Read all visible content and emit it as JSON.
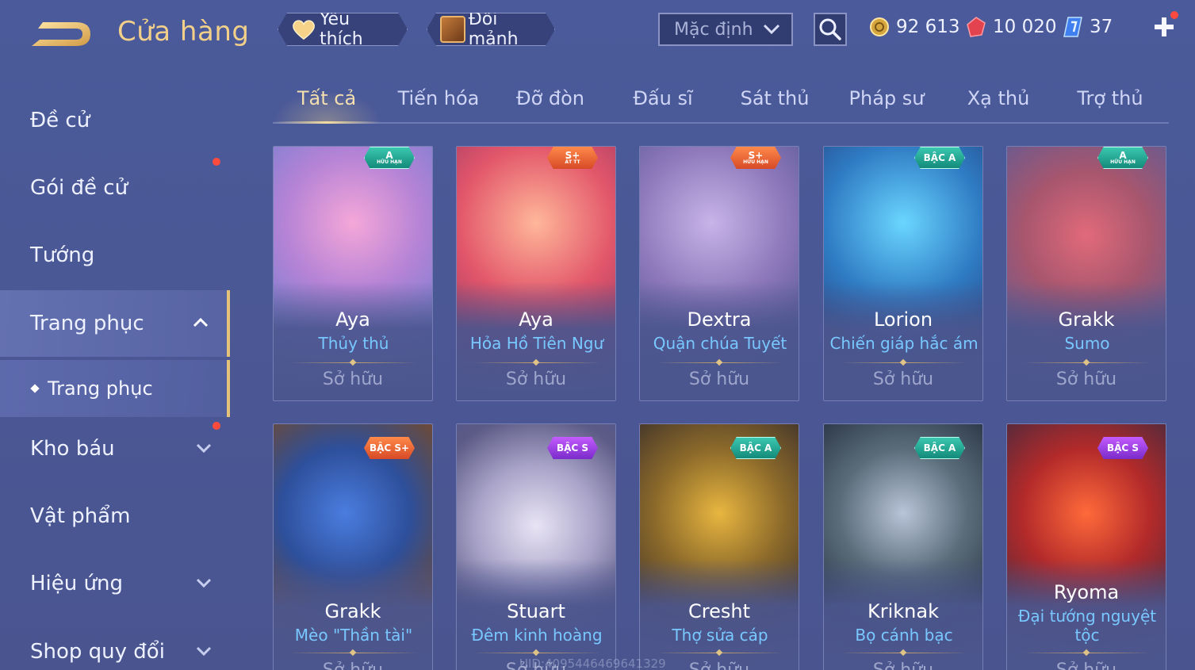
{
  "header": {
    "title": "Cửa hàng",
    "favorites_label": "Yêu thích",
    "shard_exchange_label": "Đổi mảnh",
    "sort_value": "Mặc định",
    "currencies": {
      "gold": "92 613",
      "ruby": "10 020",
      "voucher": "37"
    }
  },
  "sidebar": {
    "items": [
      {
        "label": "Đề cử"
      },
      {
        "label": "Gói đề cử"
      },
      {
        "label": "Tướng"
      },
      {
        "label": "Trang phục"
      },
      {
        "label": "Kho báu"
      },
      {
        "label": "Vật phẩm"
      },
      {
        "label": "Hiệu ứng"
      },
      {
        "label": "Shop quy đổi"
      }
    ],
    "sub_item": "Trang phục"
  },
  "tabs": [
    "Tất cả",
    "Tiến hóa",
    "Đỡ đòn",
    "Đấu sĩ",
    "Sát thủ",
    "Pháp sư",
    "Xạ thủ",
    "Trợ thủ"
  ],
  "cards": [
    {
      "hero": "Aya",
      "skin": "Thủy thủ",
      "status": "Sở hữu",
      "badge": "A",
      "badge_sub": "HỮU HẠN"
    },
    {
      "hero": "Aya",
      "skin": "Hỏa Hồ Tiên Ngư",
      "status": "Sở hữu",
      "badge": "S+",
      "badge_sub": "ẢT TT"
    },
    {
      "hero": "Dextra",
      "skin": "Quận chúa Tuyết",
      "status": "Sở hữu",
      "badge": "S+",
      "badge_sub": "HỮU HẠN"
    },
    {
      "hero": "Lorion",
      "skin": "Chiến giáp hắc ám",
      "status": "Sở hữu",
      "badge": "BẬC A",
      "badge_sub": ""
    },
    {
      "hero": "Grakk",
      "skin": "Sumo",
      "status": "Sở hữu",
      "badge": "A",
      "badge_sub": "HỮU HẠN"
    },
    {
      "hero": "Grakk",
      "skin": "Mèo \"Thần tài\"",
      "status": "Sở hữu",
      "badge": "BẬC S+",
      "badge_sub": ""
    },
    {
      "hero": "Stuart",
      "skin": "Đêm kinh hoàng",
      "status": "Sở hữu",
      "badge": "BẬC S",
      "badge_sub": ""
    },
    {
      "hero": "Cresht",
      "skin": "Thợ sửa cáp",
      "status": "Sở hữu",
      "badge": "BẬC A",
      "badge_sub": ""
    },
    {
      "hero": "Kriknak",
      "skin": "Bọ cánh bạc",
      "status": "Sở hữu",
      "badge": "BẬC A",
      "badge_sub": ""
    },
    {
      "hero": "Ryoma",
      "skin": "Đại tướng nguyệt tộc",
      "status": "Sở hữu",
      "badge": "BẬC S",
      "badge_sub": ""
    }
  ],
  "watermark": "UID:4095446469641329",
  "colors": {
    "accent_gold": "#f2d08a",
    "skin_name_blue": "#78c8ff",
    "notification_red": "#ff4b3d"
  }
}
